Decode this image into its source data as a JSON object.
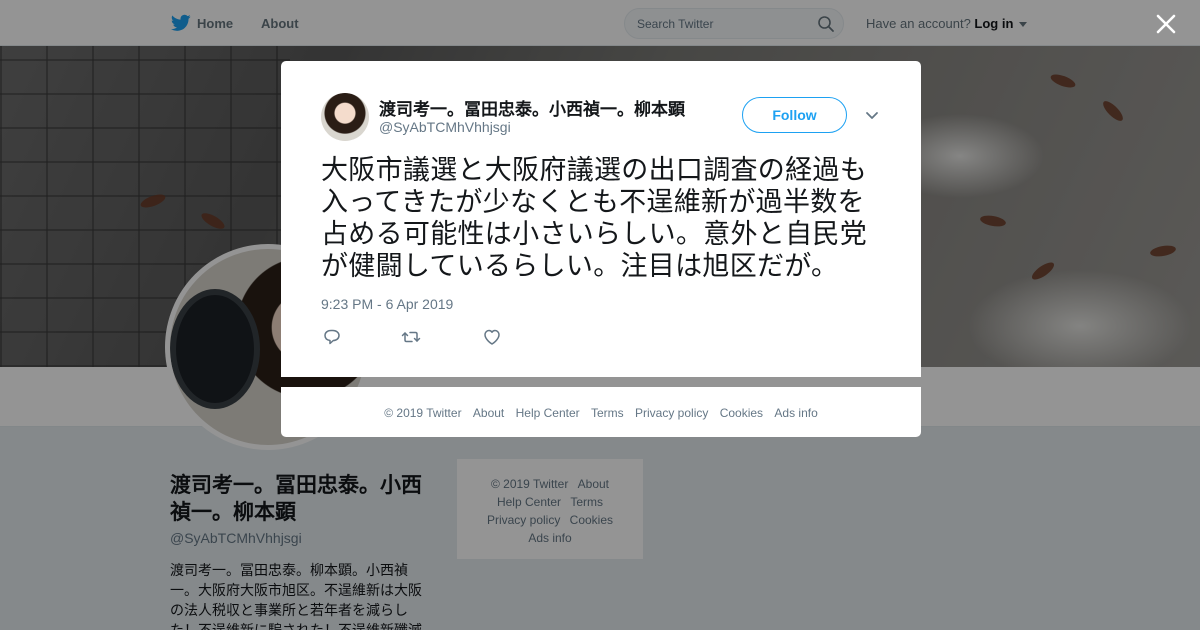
{
  "nav": {
    "home_label": "Home",
    "about_label": "About",
    "search_placeholder": "Search Twitter",
    "account_prompt": "Have an account?",
    "login_label": "Log in"
  },
  "profile": {
    "name": "渡司考一。冨田忠泰。小西禎一。柳本顕",
    "handle": "@SyAbTCMhVhhjsgi",
    "bio": "渡司考一。冨田忠泰。柳本顕。小西禎一。大阪府大阪市旭区。不逞維新は大阪の法人税収と事業所と若年者を減らした！不逞維新に騙された！不逞維新殲滅"
  },
  "side_footer": {
    "items": [
      "© 2019 Twitter",
      "About",
      "Help Center",
      "Terms",
      "Privacy policy",
      "Cookies",
      "Ads info"
    ]
  },
  "tweet": {
    "author_name": "渡司考一。冨田忠泰。小西禎一。柳本顕",
    "author_handle": "@SyAbTCMhVhhjsgi",
    "follow_label": "Follow",
    "text": "大阪市議選と大阪府議選の出口調査の経過も入ってきたが少なくとも不逞維新が過半数を占める可能性は小さいらしい。意外と自民党が健闘しているらしい。注目は旭区だが。",
    "timestamp": "9:23 PM - 6 Apr 2019"
  },
  "modal_footer": {
    "items": [
      "© 2019 Twitter",
      "About",
      "Help Center",
      "Terms",
      "Privacy policy",
      "Cookies",
      "Ads info"
    ]
  },
  "colors": {
    "accent": "#1da1f2",
    "text_primary": "#14171a",
    "text_secondary": "#657786",
    "overlay": "rgba(0,0,0,0.42)"
  },
  "icons": [
    "twitter-bird-icon",
    "search-icon",
    "close-icon",
    "chevron-down-icon",
    "reply-icon",
    "retweet-icon",
    "like-icon"
  ]
}
